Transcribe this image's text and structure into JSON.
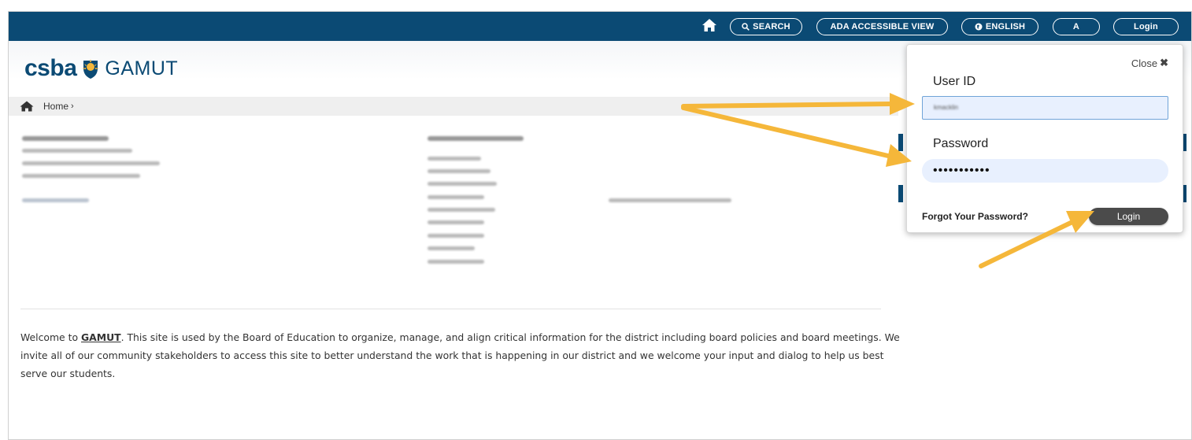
{
  "topbar": {
    "search_label": "SEARCH",
    "ada_label": "ADA ACCESSIBLE VIEW",
    "language_label": "ENGLISH",
    "font_size_label": "A",
    "login_label": "Login",
    "bar_color": "#0b4a74"
  },
  "header": {
    "logo_primary": "csba",
    "logo_secondary": "GAMUT"
  },
  "breadcrumb": {
    "home_label": "Home",
    "separator": "›"
  },
  "main": {
    "welcome_before": "Welcome to ",
    "welcome_link": "GAMUT",
    "welcome_after": ".  This site is used by the Board of Education to organize, manage, and align critical information for the district including board policies and board meetings.  We invite all of our community stakeholders to access this site to better understand the work that is happening in our district and we welcome your input and dialog to help us best serve our students."
  },
  "login_popup": {
    "close_label": "Close",
    "close_symbol": "✖",
    "user_id_label": "User ID",
    "user_id_value": "kmacklin",
    "password_label": "Password",
    "password_value": "•••••••••••",
    "forgot_label": "Forgot Your Password?",
    "login_button_label": "Login"
  },
  "colors": {
    "brand_blue": "#0b4a74",
    "accent_orange": "#f5b73a",
    "login_button": "#4b4b4b",
    "autofill_blue": "#e8f0fe"
  },
  "icons": {
    "top_home": "home-icon",
    "search": "search-icon",
    "globe": "globe-icon",
    "breadcrumb_home": "home-icon",
    "logo_mark": "sun-shield-icon"
  }
}
